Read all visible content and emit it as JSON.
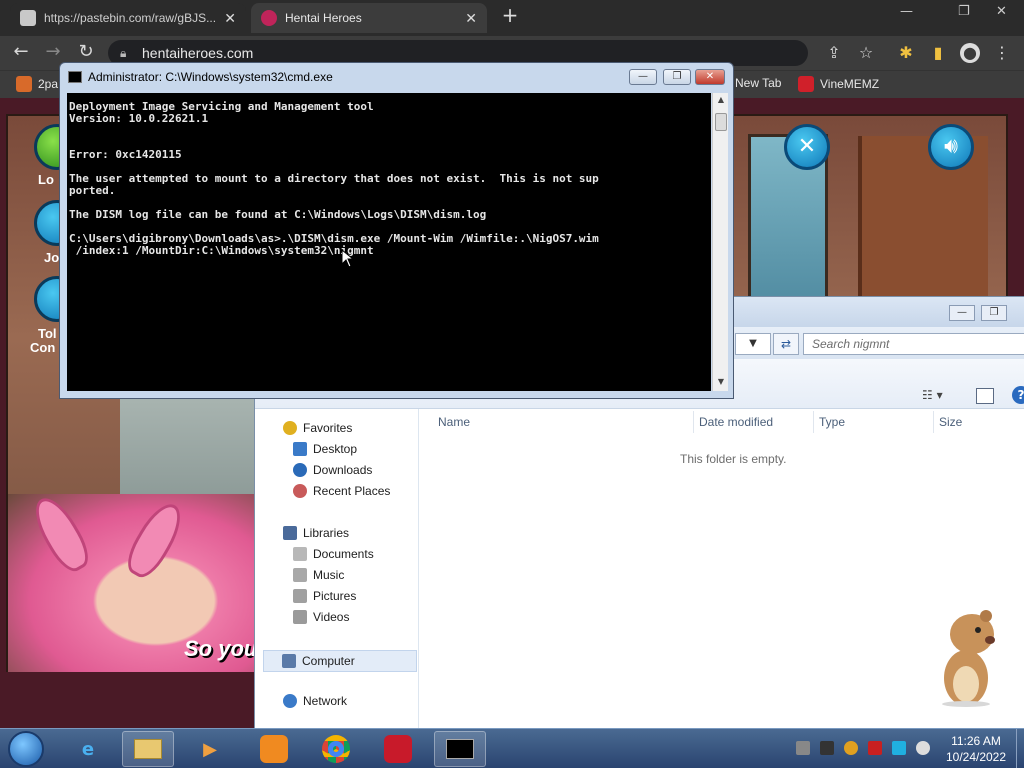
{
  "browser": {
    "tabs": [
      {
        "title": "https://pastebin.com/raw/gBJS...",
        "active": false
      },
      {
        "title": "Hentai Heroes",
        "active": true
      }
    ],
    "url": "hentaiheroes.com",
    "bookmarks": [
      "2pa",
      "New Tab",
      "VineMEMZ"
    ]
  },
  "game": {
    "side_labels": [
      "Lo",
      "Jo",
      "Tol",
      "Con"
    ],
    "dialog_text": "So you"
  },
  "cmd": {
    "title": "Administrator: C:\\Windows\\system32\\cmd.exe",
    "lines": [
      "Deployment Image Servicing and Management tool",
      "Version: 10.0.22621.1",
      "",
      "",
      "Error: 0xc1420115",
      "",
      "The user attempted to mount to a directory that does not exist.  This is not sup",
      "ported.",
      "",
      "The DISM log file can be found at C:\\Windows\\Logs\\DISM\\dism.log",
      "",
      "C:\\Users\\digibrony\\Downloads\\as>.\\DISM\\dism.exe /Mount-Wim /Wimfile:.\\NigOS7.wim",
      " /index:1 /MountDir:C:\\Windows\\system32\\nigmnt"
    ]
  },
  "explorer": {
    "search_placeholder": "Search nigmnt",
    "columns": [
      "Name",
      "Date modified",
      "Type",
      "Size"
    ],
    "empty_text": "This folder is empty.",
    "nav": {
      "favorites": "Favorites",
      "favorites_items": [
        "Desktop",
        "Downloads",
        "Recent Places"
      ],
      "libraries": "Libraries",
      "libraries_items": [
        "Documents",
        "Music",
        "Pictures",
        "Videos"
      ],
      "computer": "Computer",
      "network": "Network"
    }
  },
  "taskbar": {
    "time": "11:26 AM",
    "date": "10/24/2022"
  },
  "colors": {
    "cmd_bg": "#000000",
    "taskbar": "#2a4470",
    "chrome_bg": "#3c3c3c"
  }
}
